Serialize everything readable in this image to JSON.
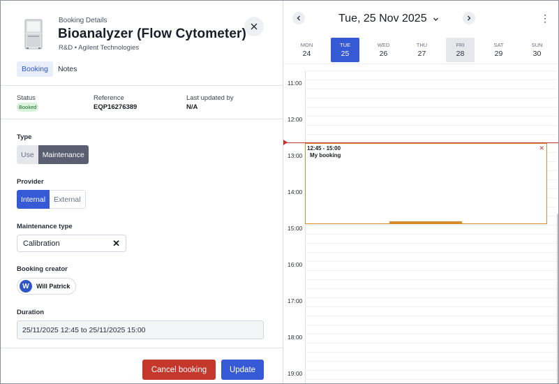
{
  "booking": {
    "header_label": "Booking Details",
    "title": "Bioanalyzer (Flow Cytometer)",
    "subtitle": "R&D • Agilent Technologies"
  },
  "tabs": [
    {
      "label": "Booking",
      "active": true
    },
    {
      "label": "Notes",
      "active": false
    }
  ],
  "meta": {
    "status_label": "Status",
    "status_value": "Booked",
    "reference_label": "Reference",
    "reference_value": "EQP16276389",
    "updated_label": "Last updated by",
    "updated_value": "N/A"
  },
  "form": {
    "type_label": "Type",
    "type_options": [
      "Use",
      "Maintenance"
    ],
    "type_selected": "Maintenance",
    "provider_label": "Provider",
    "provider_options": [
      "Internal",
      "External"
    ],
    "provider_selected": "Internal",
    "maintenance_label": "Maintenance type",
    "maintenance_value": "Calibration",
    "creator_label": "Booking creator",
    "creator_initial": "W",
    "creator_name": "Will Patrick",
    "duration_label": "Duration",
    "duration_value": "25/11/2025 12:45 to 25/11/2025 15:00"
  },
  "actions": {
    "cancel_label": "Cancel booking",
    "update_label": "Update"
  },
  "calendar": {
    "current_date": "Tue, 25 Nov 2025",
    "days": [
      {
        "name": "MON",
        "date": "24",
        "state": "normal"
      },
      {
        "name": "TUE",
        "date": "25",
        "state": "selected"
      },
      {
        "name": "WED",
        "date": "26",
        "state": "normal"
      },
      {
        "name": "THU",
        "date": "27",
        "state": "normal"
      },
      {
        "name": "FRI",
        "date": "28",
        "state": "grey"
      },
      {
        "name": "SAT",
        "date": "29",
        "state": "normal"
      },
      {
        "name": "SUN",
        "date": "30",
        "state": "normal"
      }
    ],
    "hours": [
      "11:00",
      "12:00",
      "13:00",
      "14:00",
      "15:00",
      "16:00",
      "17:00",
      "18:00",
      "19:00"
    ],
    "event": {
      "time": "12:45 - 15:00",
      "title": "My booking"
    }
  },
  "colors": {
    "primary": "#3659d6",
    "danger": "#c4382b",
    "event_border": "#d98a2b",
    "badge_bg": "#d8f2dc"
  },
  "icons": {
    "close": "close-icon",
    "prev": "chevron-left-icon",
    "next": "chevron-right-icon",
    "dropdown": "chevron-down-icon",
    "menu": "kebab-menu-icon",
    "clear": "clear-icon",
    "device": "instrument-icon"
  }
}
